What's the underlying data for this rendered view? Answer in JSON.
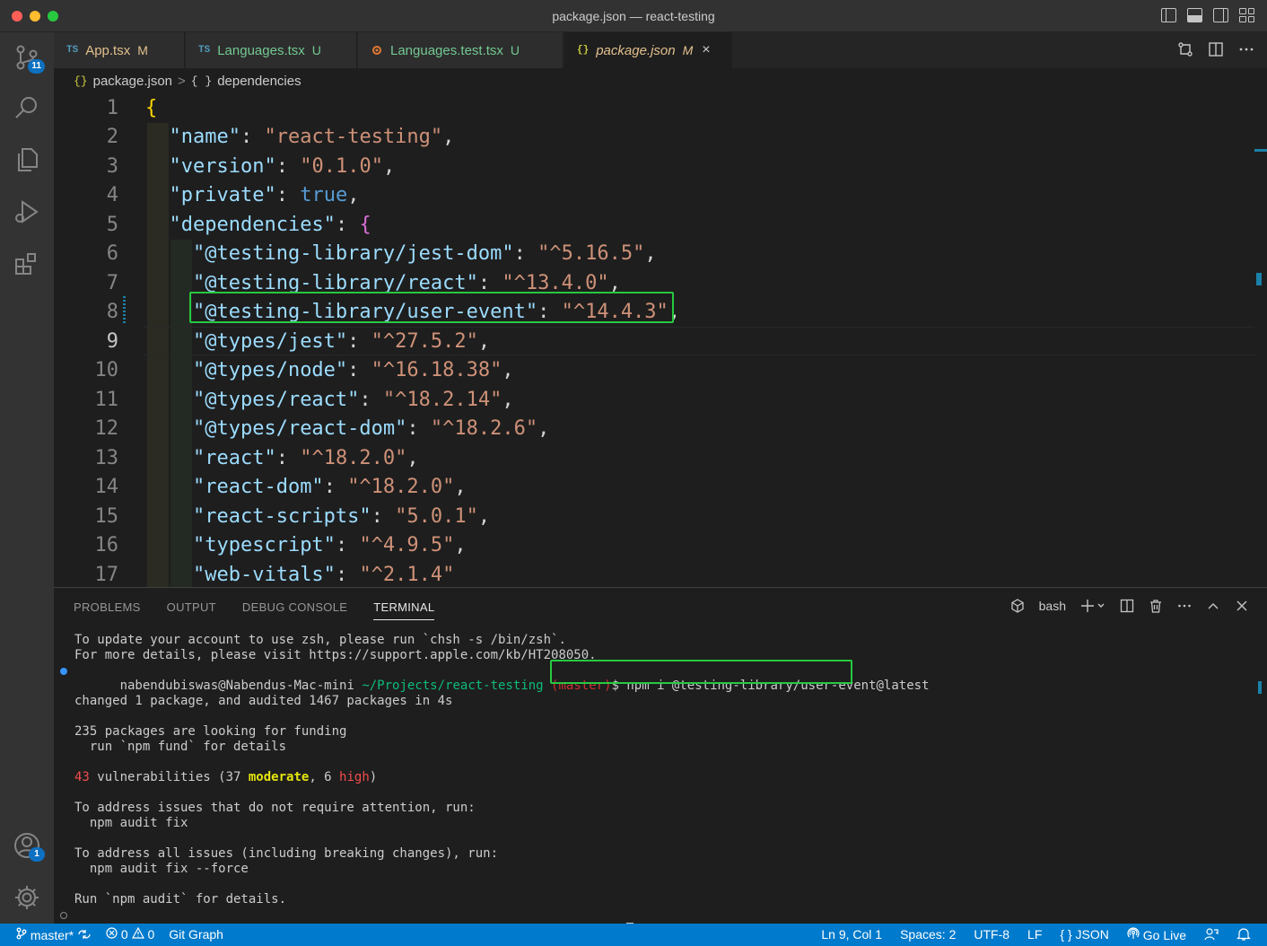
{
  "window": {
    "title": "package.json — react-testing"
  },
  "activity_bar": {
    "source_control_badge": "11",
    "accounts_badge": "1"
  },
  "tabs": [
    {
      "icon": "TS",
      "label": "App.tsx",
      "status": "M"
    },
    {
      "icon": "TS",
      "label": "Languages.tsx",
      "status": "U"
    },
    {
      "icon": "gear-test",
      "label": "Languages.test.tsx",
      "status": "U"
    },
    {
      "icon": "{}",
      "label": "package.json",
      "status": "M",
      "close": "×"
    }
  ],
  "breadcrumb": {
    "file_icon": "{}",
    "file": "package.json",
    "separator": ">",
    "symbol_icon": "{ }",
    "symbol": "dependencies"
  },
  "editor": {
    "current_line": 9,
    "lines": [
      {
        "n": "1",
        "indent": "",
        "key": "",
        "colon": "",
        "value": "",
        "open": "{",
        "comma": ""
      },
      {
        "n": "2",
        "indent": "  ",
        "key": "\"name\"",
        "colon": ": ",
        "value": "\"react-testing\"",
        "comma": ","
      },
      {
        "n": "3",
        "indent": "  ",
        "key": "\"version\"",
        "colon": ": ",
        "value": "\"0.1.0\"",
        "comma": ","
      },
      {
        "n": "4",
        "indent": "  ",
        "key": "\"private\"",
        "colon": ": ",
        "value": "true",
        "comma": ","
      },
      {
        "n": "5",
        "indent": "  ",
        "key": "\"dependencies\"",
        "colon": ": ",
        "value": "{",
        "comma": ""
      },
      {
        "n": "6",
        "indent": "    ",
        "key": "\"@testing-library/jest-dom\"",
        "colon": ": ",
        "value": "\"^5.16.5\"",
        "comma": ","
      },
      {
        "n": "7",
        "indent": "    ",
        "key": "\"@testing-library/react\"",
        "colon": ": ",
        "value": "\"^13.4.0\"",
        "comma": ","
      },
      {
        "n": "8",
        "indent": "    ",
        "key": "\"@testing-library/user-event\"",
        "colon": ": ",
        "value": "\"^14.4.3\"",
        "comma": ","
      },
      {
        "n": "9",
        "indent": "    ",
        "key": "\"@types/jest\"",
        "colon": ": ",
        "value": "\"^27.5.2\"",
        "comma": ","
      },
      {
        "n": "10",
        "indent": "    ",
        "key": "\"@types/node\"",
        "colon": ": ",
        "value": "\"^16.18.38\"",
        "comma": ","
      },
      {
        "n": "11",
        "indent": "    ",
        "key": "\"@types/react\"",
        "colon": ": ",
        "value": "\"^18.2.14\"",
        "comma": ","
      },
      {
        "n": "12",
        "indent": "    ",
        "key": "\"@types/react-dom\"",
        "colon": ": ",
        "value": "\"^18.2.6\"",
        "comma": ","
      },
      {
        "n": "13",
        "indent": "    ",
        "key": "\"react\"",
        "colon": ": ",
        "value": "\"^18.2.0\"",
        "comma": ","
      },
      {
        "n": "14",
        "indent": "    ",
        "key": "\"react-dom\"",
        "colon": ": ",
        "value": "\"^18.2.0\"",
        "comma": ","
      },
      {
        "n": "15",
        "indent": "    ",
        "key": "\"react-scripts\"",
        "colon": ": ",
        "value": "\"5.0.1\"",
        "comma": ","
      },
      {
        "n": "16",
        "indent": "    ",
        "key": "\"typescript\"",
        "colon": ": ",
        "value": "\"^4.9.5\"",
        "comma": ","
      },
      {
        "n": "17",
        "indent": "    ",
        "key": "\"web-vitals\"",
        "colon": ": ",
        "value": "\"^2.1.4\"",
        "comma": ""
      }
    ]
  },
  "panel": {
    "tabs": [
      "PROBLEMS",
      "OUTPUT",
      "DEBUG CONSOLE",
      "TERMINAL"
    ],
    "active_tab": "TERMINAL",
    "shell": "bash",
    "terminal": {
      "l1": "To update your account to use zsh, please run `chsh -s /bin/zsh`.",
      "l2": "For more details, please visit https://support.apple.com/kb/HT208050.",
      "prompt_user": "nabendubiswas@Nabendus-Mac-mini",
      "prompt_path": "~/Projects/react-testing",
      "prompt_branch": "(master)",
      "prompt_symbol": "$",
      "command": "npm i @testing-library/user-event@latest",
      "l4": "changed 1 package, and audited 1467 packages in 4s",
      "l5": "235 packages are looking for funding",
      "l6": "  run `npm fund` for details",
      "vuln_count": "43",
      "vuln_text": " vulnerabilities (37 ",
      "vuln_moderate": "moderate",
      "vuln_mid": ", 6 ",
      "vuln_high": "high",
      "vuln_close": ")",
      "l8": "To address issues that do not require attention, run:",
      "l9": "  npm audit fix",
      "l10": "To address all issues (including breaking changes), run:",
      "l11": "  npm audit fix --force",
      "l12": "Run `npm audit` for details."
    }
  },
  "status_bar": {
    "branch": "master*",
    "errors": "0",
    "warnings": "0",
    "git_graph": "Git Graph",
    "position": "Ln 9, Col 1",
    "spaces": "Spaces: 2",
    "encoding": "UTF-8",
    "eol": "LF",
    "language": "JSON",
    "language_icon": "{ }",
    "go_live": "Go Live"
  },
  "colors": {
    "accent": "#007acc",
    "highlight": "#27c93f"
  }
}
